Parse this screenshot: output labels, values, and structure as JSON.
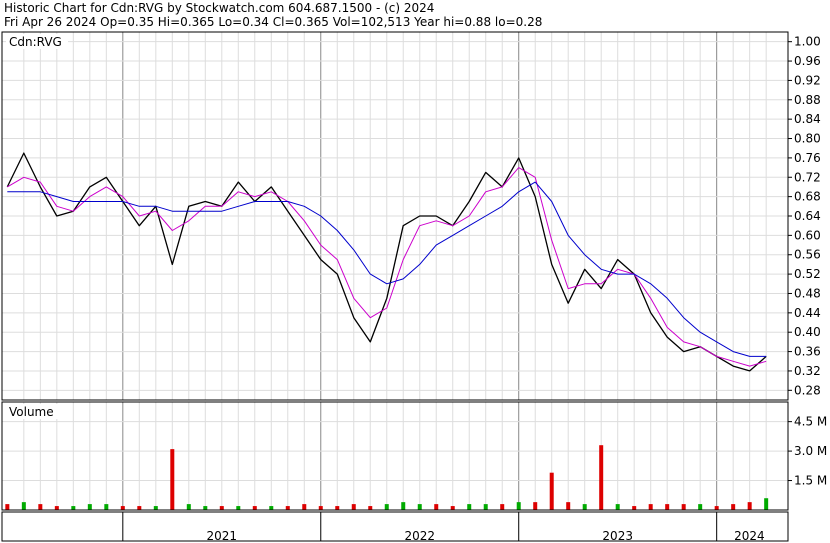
{
  "header": {
    "line1": "Historic Chart for Cdn:RVG by Stockwatch.com 604.687.1500 - (c) 2024",
    "line2": "Fri Apr 26 2024  Op=0.35  Hi=0.365  Lo=0.34  Cl=0.365  Vol=102,513  Year hi=0.88  lo=0.28"
  },
  "chart_data": [
    {
      "type": "line",
      "panel_label": "Cdn:RVG",
      "x_labels": [
        "2021",
        "2022",
        "2023",
        "2024"
      ],
      "y_ticks": [
        "1.00",
        "0.96",
        "0.92",
        "0.88",
        "0.84",
        "0.80",
        "0.76",
        "0.72",
        "0.68",
        "0.64",
        "0.60",
        "0.56",
        "0.52",
        "0.48",
        "0.44",
        "0.40",
        "0.36",
        "0.32",
        "0.28"
      ],
      "ylim": [
        0.26,
        1.02
      ],
      "grid": true,
      "colors": {
        "price": "#000000",
        "ma_short": "#cc00cc",
        "ma_long": "#0000cc"
      },
      "series": [
        {
          "role": "price",
          "x": [
            "2020-06",
            "2020-07",
            "2020-08",
            "2020-09",
            "2020-10",
            "2020-11",
            "2020-12",
            "2021-01",
            "2021-02",
            "2021-03",
            "2021-04",
            "2021-05",
            "2021-06",
            "2021-07",
            "2021-08",
            "2021-09",
            "2021-10",
            "2021-11",
            "2021-12",
            "2022-01",
            "2022-02",
            "2022-03",
            "2022-04",
            "2022-05",
            "2022-06",
            "2022-07",
            "2022-08",
            "2022-09",
            "2022-10",
            "2022-11",
            "2022-12",
            "2023-01",
            "2023-02",
            "2023-03",
            "2023-04",
            "2023-05",
            "2023-06",
            "2023-07",
            "2023-08",
            "2023-09",
            "2023-10",
            "2023-11",
            "2023-12",
            "2024-01",
            "2024-02",
            "2024-03",
            "2024-04"
          ],
          "y": [
            0.7,
            0.77,
            0.7,
            0.64,
            0.65,
            0.7,
            0.72,
            0.67,
            0.62,
            0.66,
            0.54,
            0.66,
            0.67,
            0.66,
            0.71,
            0.67,
            0.7,
            0.65,
            0.6,
            0.55,
            0.52,
            0.43,
            0.38,
            0.47,
            0.62,
            0.64,
            0.64,
            0.62,
            0.67,
            0.73,
            0.7,
            0.76,
            0.68,
            0.54,
            0.46,
            0.53,
            0.49,
            0.55,
            0.52,
            0.44,
            0.39,
            0.36,
            0.37,
            0.35,
            0.33,
            0.32,
            0.35
          ]
        },
        {
          "role": "ma_short",
          "x": [
            "2020-06",
            "2020-07",
            "2020-08",
            "2020-09",
            "2020-10",
            "2020-11",
            "2020-12",
            "2021-01",
            "2021-02",
            "2021-03",
            "2021-04",
            "2021-05",
            "2021-06",
            "2021-07",
            "2021-08",
            "2021-09",
            "2021-10",
            "2021-11",
            "2021-12",
            "2022-01",
            "2022-02",
            "2022-03",
            "2022-04",
            "2022-05",
            "2022-06",
            "2022-07",
            "2022-08",
            "2022-09",
            "2022-10",
            "2022-11",
            "2022-12",
            "2023-01",
            "2023-02",
            "2023-03",
            "2023-04",
            "2023-05",
            "2023-06",
            "2023-07",
            "2023-08",
            "2023-09",
            "2023-10",
            "2023-11",
            "2023-12",
            "2024-01",
            "2024-02",
            "2024-03",
            "2024-04"
          ],
          "y": [
            0.7,
            0.72,
            0.71,
            0.66,
            0.65,
            0.68,
            0.7,
            0.68,
            0.64,
            0.65,
            0.61,
            0.63,
            0.66,
            0.66,
            0.69,
            0.68,
            0.69,
            0.67,
            0.63,
            0.58,
            0.55,
            0.47,
            0.43,
            0.45,
            0.55,
            0.62,
            0.63,
            0.62,
            0.64,
            0.69,
            0.7,
            0.74,
            0.72,
            0.59,
            0.49,
            0.5,
            0.5,
            0.53,
            0.52,
            0.47,
            0.41,
            0.38,
            0.37,
            0.35,
            0.34,
            0.33,
            0.34
          ]
        },
        {
          "role": "ma_long",
          "x": [
            "2020-06",
            "2020-07",
            "2020-08",
            "2020-09",
            "2020-10",
            "2020-11",
            "2020-12",
            "2021-01",
            "2021-02",
            "2021-03",
            "2021-04",
            "2021-05",
            "2021-06",
            "2021-07",
            "2021-08",
            "2021-09",
            "2021-10",
            "2021-11",
            "2021-12",
            "2022-01",
            "2022-02",
            "2022-03",
            "2022-04",
            "2022-05",
            "2022-06",
            "2022-07",
            "2022-08",
            "2022-09",
            "2022-10",
            "2022-11",
            "2022-12",
            "2023-01",
            "2023-02",
            "2023-03",
            "2023-04",
            "2023-05",
            "2023-06",
            "2023-07",
            "2023-08",
            "2023-09",
            "2023-10",
            "2023-11",
            "2023-12",
            "2024-01",
            "2024-02",
            "2024-03",
            "2024-04"
          ],
          "y": [
            0.69,
            0.69,
            0.69,
            0.68,
            0.67,
            0.67,
            0.67,
            0.67,
            0.66,
            0.66,
            0.65,
            0.65,
            0.65,
            0.65,
            0.66,
            0.67,
            0.67,
            0.67,
            0.66,
            0.64,
            0.61,
            0.57,
            0.52,
            0.5,
            0.51,
            0.54,
            0.58,
            0.6,
            0.62,
            0.64,
            0.66,
            0.69,
            0.71,
            0.67,
            0.6,
            0.56,
            0.53,
            0.52,
            0.52,
            0.5,
            0.47,
            0.43,
            0.4,
            0.38,
            0.36,
            0.35,
            0.35
          ]
        }
      ]
    },
    {
      "type": "bar",
      "panel_label": "Volume",
      "y_ticks": [
        "4.5 M",
        "3.0 M",
        "1.5 M"
      ],
      "ylim": [
        0,
        5.5
      ],
      "unit": "M",
      "colors": {
        "up": "#00aa00",
        "down": "#dd0000"
      },
      "series": [
        {
          "x": [
            "2020-06",
            "2020-07",
            "2020-08",
            "2020-09",
            "2020-10",
            "2020-11",
            "2020-12",
            "2021-01",
            "2021-02",
            "2021-03",
            "2021-04",
            "2021-05",
            "2021-06",
            "2021-07",
            "2021-08",
            "2021-09",
            "2021-10",
            "2021-11",
            "2021-12",
            "2022-01",
            "2022-02",
            "2022-03",
            "2022-04",
            "2022-05",
            "2022-06",
            "2022-07",
            "2022-08",
            "2022-09",
            "2022-10",
            "2022-11",
            "2022-12",
            "2023-01",
            "2023-02",
            "2023-03",
            "2023-04",
            "2023-05",
            "2023-06",
            "2023-07",
            "2023-08",
            "2023-09",
            "2023-10",
            "2023-11",
            "2023-12",
            "2024-01",
            "2024-02",
            "2024-03",
            "2024-04"
          ],
          "values": [
            0.3,
            0.4,
            0.3,
            0.2,
            0.2,
            0.3,
            0.3,
            0.2,
            0.2,
            0.2,
            3.1,
            0.3,
            0.2,
            0.2,
            0.2,
            0.2,
            0.2,
            0.2,
            0.3,
            0.2,
            0.2,
            0.3,
            0.2,
            0.3,
            0.4,
            0.3,
            0.3,
            0.2,
            0.3,
            0.3,
            0.3,
            0.4,
            0.4,
            1.9,
            0.4,
            0.3,
            3.3,
            0.3,
            0.2,
            0.3,
            0.3,
            0.3,
            0.3,
            0.2,
            0.3,
            0.4,
            0.6
          ],
          "direction": [
            "down",
            "up",
            "down",
            "down",
            "up",
            "up",
            "up",
            "down",
            "down",
            "up",
            "down",
            "up",
            "up",
            "down",
            "up",
            "down",
            "up",
            "down",
            "down",
            "down",
            "down",
            "down",
            "down",
            "up",
            "up",
            "up",
            "down",
            "down",
            "up",
            "up",
            "down",
            "up",
            "down",
            "down",
            "down",
            "up",
            "down",
            "up",
            "down",
            "down",
            "down",
            "down",
            "up",
            "down",
            "down",
            "down",
            "up"
          ]
        }
      ]
    }
  ]
}
